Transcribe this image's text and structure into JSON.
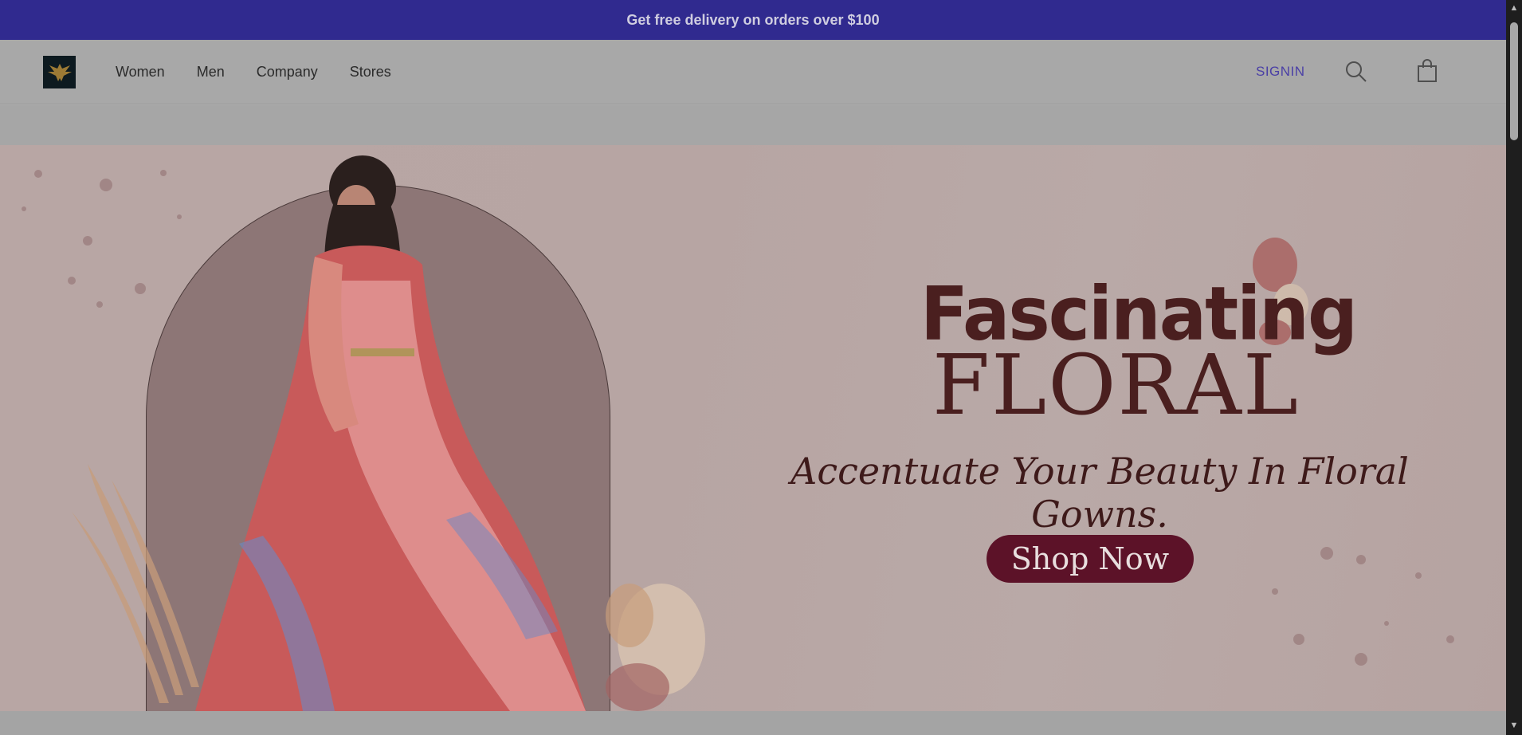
{
  "promo": {
    "text": "Get free delivery on orders over $100"
  },
  "header": {
    "nav": [
      "Women",
      "Men",
      "Company",
      "Stores"
    ],
    "signin_label": "SIGNIN",
    "icons": {
      "logo": "eagle-logo",
      "search": "search-icon",
      "cart": "shopping-bag-icon"
    }
  },
  "hero": {
    "headline": "Fascinating",
    "subhead": "FLORAL",
    "tagline": "Accentuate Your Beauty In Floral Gowns.",
    "cta_label": "Shop Now"
  },
  "colors": {
    "promo_bg": "#302a8f",
    "signin": "#4a3fa6",
    "headline": "#4a1f1f",
    "cta_bg": "#5c1228"
  }
}
